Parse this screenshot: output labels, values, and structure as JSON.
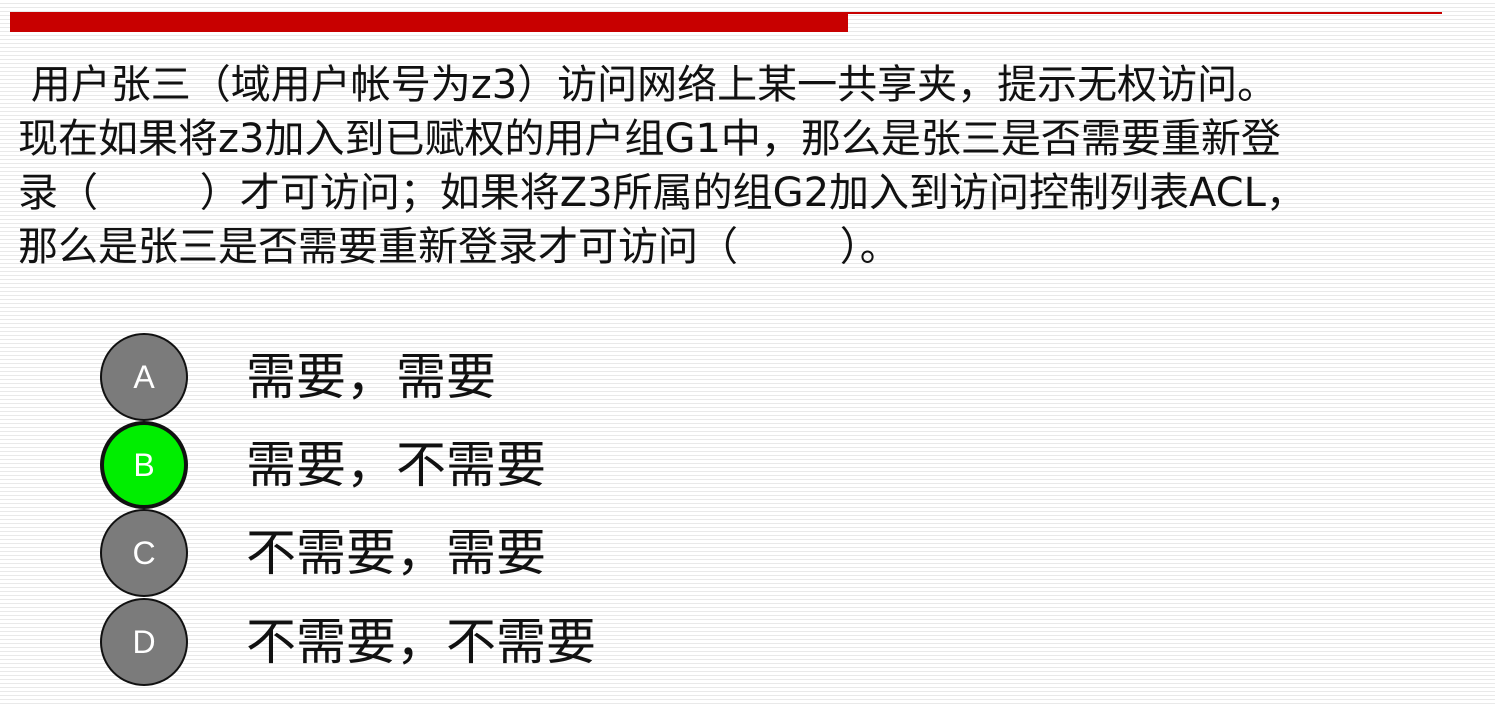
{
  "header": {
    "accent_color": "#c80000"
  },
  "question": {
    "lines": [
      " 用户张三（域用户帐号为z3）访问网络上某一共享夹，提示无权访问。",
      "现在如果将z3加入到已赋权的用户组G1中，那么是张三是否需要重新登",
      "录（        ）才可访问；如果将Z3所属的组G2加入到访问控制列表ACL，",
      "那么是张三是否需要重新登录才可访问（        ）。"
    ]
  },
  "options": [
    {
      "letter": "A",
      "text": "需要，需要",
      "selected": false
    },
    {
      "letter": "B",
      "text": "需要，不需要",
      "selected": true
    },
    {
      "letter": "C",
      "text": "不需要，需要",
      "selected": false
    },
    {
      "letter": "D",
      "text": "不需要，不需要",
      "selected": false
    }
  ],
  "colors": {
    "selected_circle": "#00ee00",
    "unselected_circle": "#7b7b7b"
  }
}
